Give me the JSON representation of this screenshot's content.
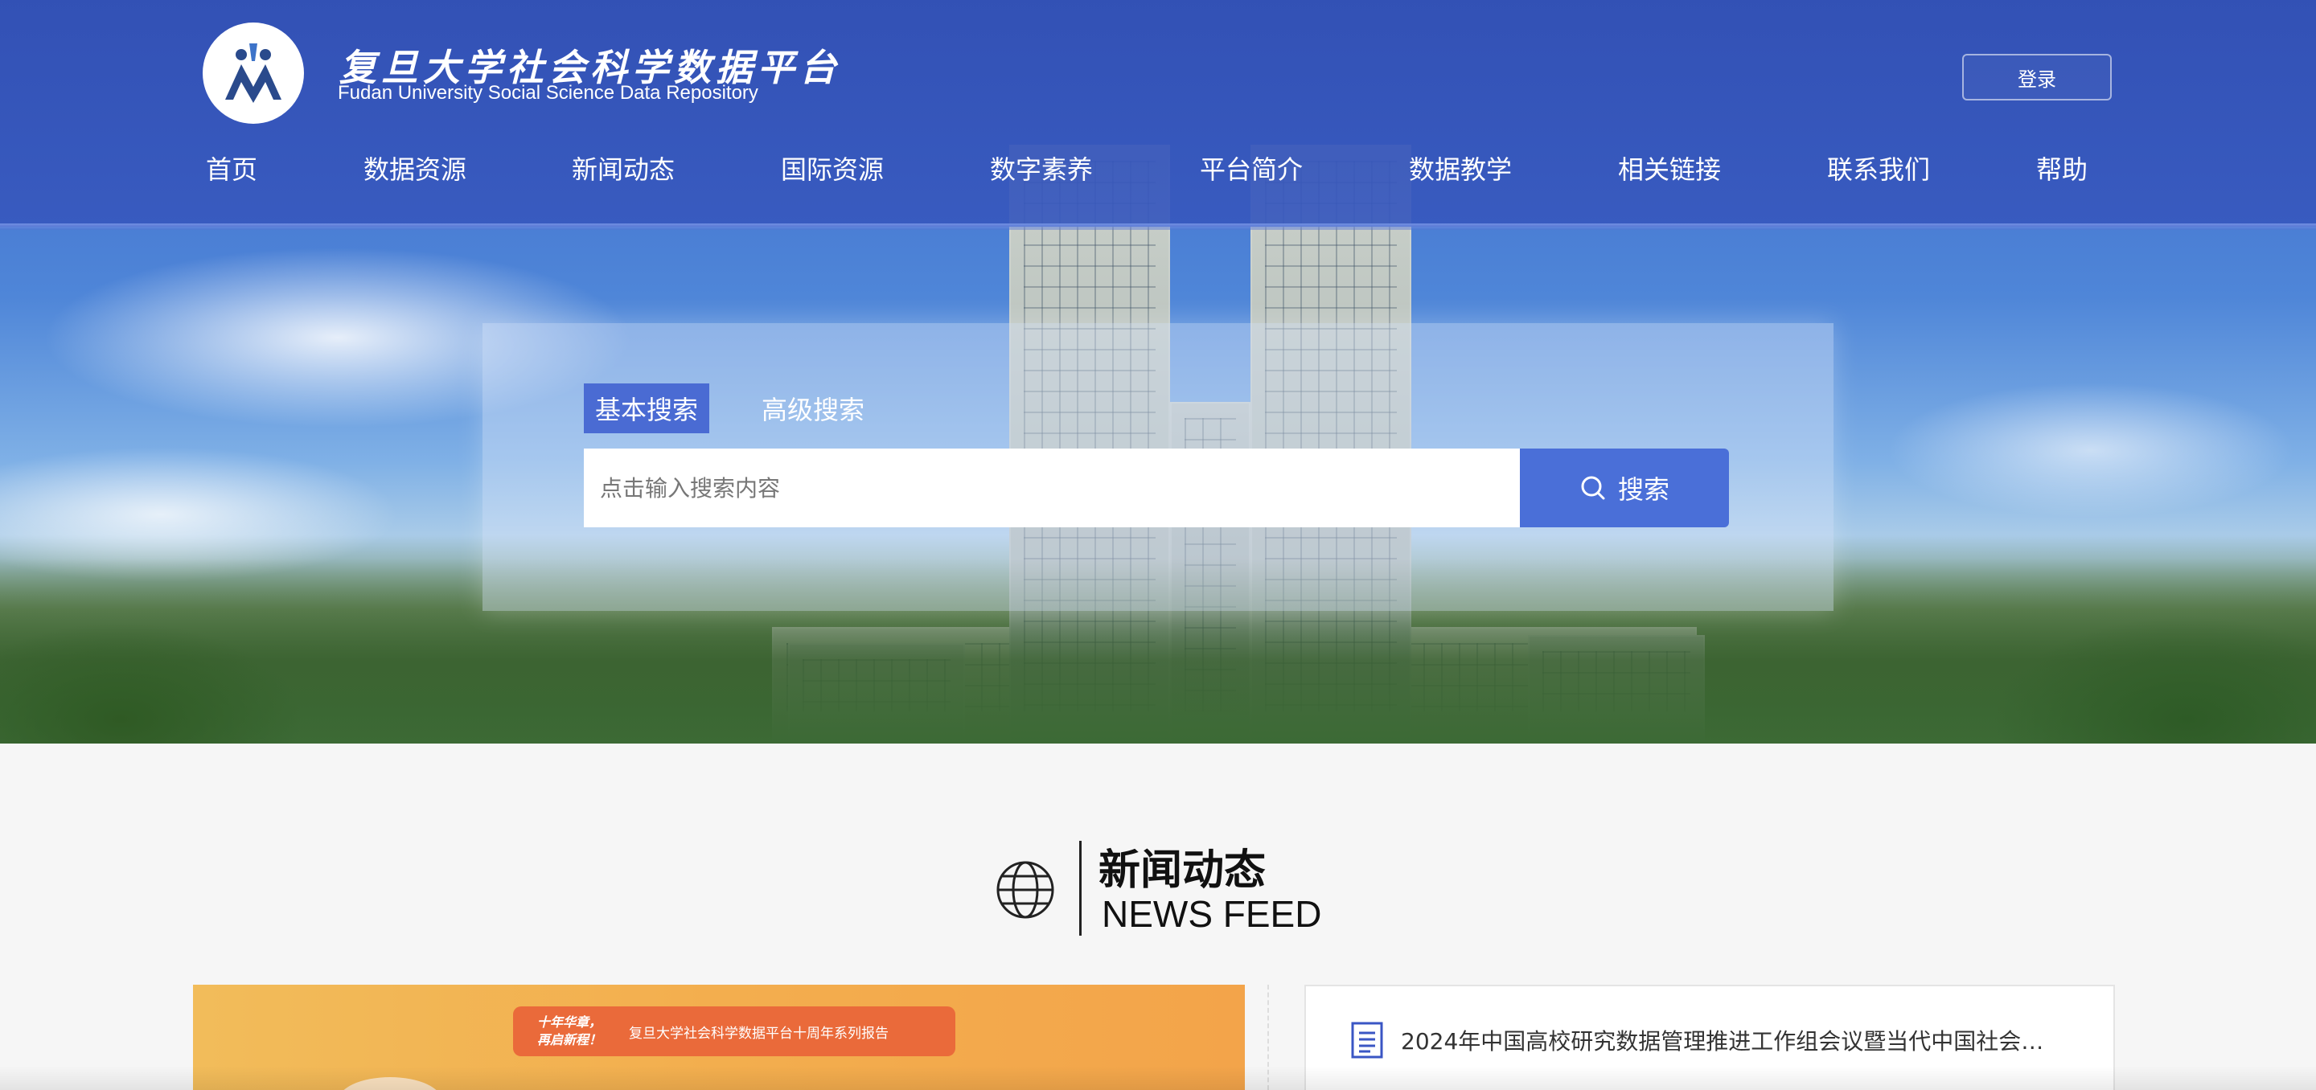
{
  "header": {
    "title_cn": "复旦大学社会科学数据平台",
    "title_en": "Fudan University Social Science Data Repository",
    "login_label": "登录"
  },
  "nav": {
    "items": [
      {
        "label": "首页"
      },
      {
        "label": "数据资源"
      },
      {
        "label": "新闻动态"
      },
      {
        "label": "国际资源"
      },
      {
        "label": "数字素养"
      },
      {
        "label": "平台简介"
      },
      {
        "label": "数据教学"
      },
      {
        "label": "相关链接"
      },
      {
        "label": "联系我们"
      },
      {
        "label": "帮助"
      }
    ]
  },
  "search": {
    "tabs": [
      {
        "label": "基本搜索",
        "active": true
      },
      {
        "label": "高级搜索",
        "active": false
      }
    ],
    "placeholder": "点击输入搜索内容",
    "value": "",
    "button_label": "搜索"
  },
  "news": {
    "heading_cn": "新闻动态",
    "heading_en": "NEWS FEED",
    "banner_left": "十年华章，\n再启新程！",
    "banner_right": "复旦大学社会科学数据平台十周年系列报告",
    "items": [
      {
        "title": "2024年中国高校研究数据管理推进工作组会议暨当代中国社会生..."
      }
    ]
  },
  "colors": {
    "header_blue": "#3552b8",
    "accent_blue": "#4a6fd8",
    "news_orange": "#f3ae4e",
    "banner_orange": "#ea6a3a"
  }
}
